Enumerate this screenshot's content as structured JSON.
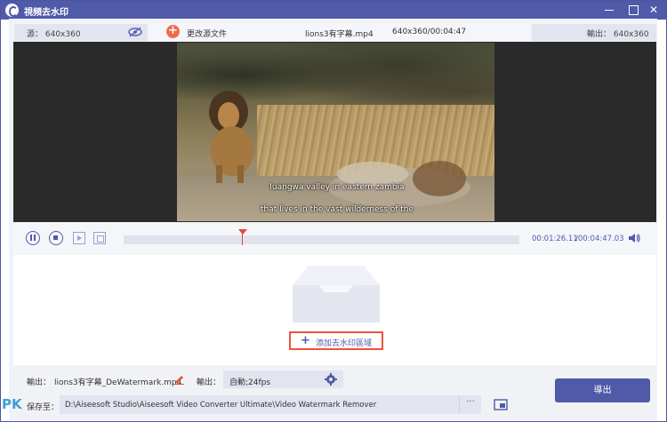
{
  "window": {
    "title": "視頻去水印"
  },
  "header": {
    "source_label": "源： 640x360",
    "change_source_label": "更改源文件",
    "file_name": "lions3有字幕.mp4",
    "file_resolution_duration": "640x360/00:04:47",
    "output_label": "輸出： 640x360"
  },
  "video": {
    "subtitle_line1": "luangwa valley in eastern zambia",
    "subtitle_line2": "that lives in the vast wilderness of the"
  },
  "playback": {
    "current_time": "00:01:26.11",
    "total_time": "/00:04:47.03",
    "progress": 0.3
  },
  "region": {
    "add_label": "添加去水印區域"
  },
  "settings": {
    "output_name_label": "輸出：",
    "output_name": "lions3有字幕_DeWatermark.mp4",
    "output_format_label": "輸出：",
    "output_format": "自動;24fps",
    "save_to_label": "保存至：",
    "save_path": "D:\\Aiseesoft Studio\\Aiseesoft Video Converter Ultimate\\Video Watermark Remover",
    "more_label": "···",
    "export_label": "導出"
  },
  "brand": {
    "corner_logo": "PK"
  },
  "colors": {
    "accent": "#4f5aa8",
    "highlight": "#e8543a",
    "add_button": "#f06a4d"
  }
}
